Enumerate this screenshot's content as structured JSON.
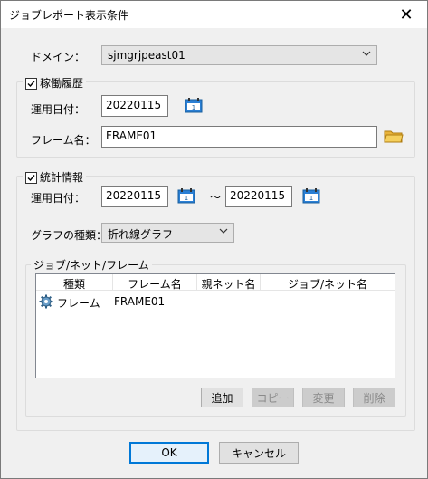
{
  "window": {
    "title": "ジョブレポート表示条件",
    "close_glyph": "✕"
  },
  "domain_field": {
    "label": "ドメイン：",
    "value": "sjmgrjpeast01"
  },
  "history": {
    "title": "稼働履歴",
    "checked": true,
    "date_label": "運用日付：",
    "date_value": "20220115",
    "frame_label": "フレーム名：",
    "frame_value": "FRAME01"
  },
  "stats": {
    "title": "統計情報",
    "checked": true,
    "date_label": "運用日付：",
    "date_from": "20220115",
    "tilde": "～",
    "date_to": "20220115",
    "graph_label": "グラフの種類：",
    "graph_value": "折れ線グラフ"
  },
  "jobnet": {
    "title": "ジョブ/ネット/フレーム",
    "columns": [
      "種類",
      "フレーム名",
      "親ネット名",
      "ジョブ/ネット名"
    ],
    "rows": [
      {
        "type": "フレーム",
        "frame": "FRAME01",
        "parent": "",
        "jobnet": ""
      }
    ],
    "buttons": {
      "add": "追加",
      "copy": "コピー",
      "change": "変更",
      "delete": "削除"
    }
  },
  "footer": {
    "ok": "OK",
    "cancel": "キャンセル"
  },
  "icons": {
    "calendar": "calendar-icon",
    "folder": "folder-icon",
    "gear": "gear-icon",
    "dropdown": "chevron-down-icon"
  },
  "colors": {
    "focus_border": "#0078d7",
    "window_bg": "#f0f0f0"
  }
}
